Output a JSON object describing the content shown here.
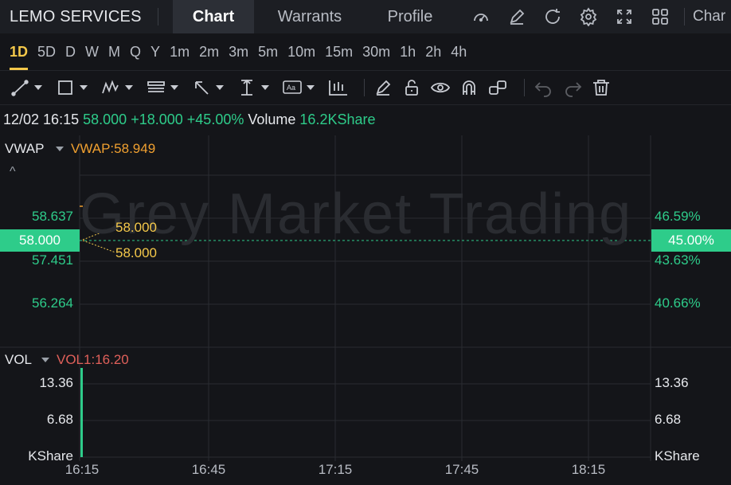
{
  "header": {
    "stock_name": "LEMO SERVICES",
    "tabs": [
      {
        "label": "Chart",
        "active": true
      },
      {
        "label": "Warrants",
        "active": false
      },
      {
        "label": "Profile",
        "active": false
      }
    ],
    "icons": [
      "gauge-icon",
      "edit-icon",
      "refresh-icon",
      "gear-icon",
      "fullscreen-icon",
      "grid-icon"
    ],
    "char_label": "Char"
  },
  "periods": [
    {
      "label": "1D",
      "active": true
    },
    {
      "label": "5D"
    },
    {
      "label": "D"
    },
    {
      "label": "W"
    },
    {
      "label": "M"
    },
    {
      "label": "Q"
    },
    {
      "label": "Y"
    },
    {
      "label": "1m"
    },
    {
      "label": "2m"
    },
    {
      "label": "3m"
    },
    {
      "label": "5m"
    },
    {
      "label": "10m"
    },
    {
      "label": "15m"
    },
    {
      "label": "30m"
    },
    {
      "label": "1h"
    },
    {
      "label": "2h"
    },
    {
      "label": "4h"
    }
  ],
  "tools": [
    "line-tool-icon",
    "rectangle-tool-icon",
    "pattern-tool-icon",
    "fib-tool-icon",
    "arrow-tool-icon",
    "measure-tool-icon",
    "text-tool-icon",
    "indicator-icon",
    "pencil-icon",
    "unlock-icon",
    "eye-icon",
    "magnet-icon",
    "link-icon",
    "undo-icon",
    "redo-icon",
    "trash-icon"
  ],
  "info": {
    "datetime": "12/02 16:15",
    "price": "58.000",
    "change": "+18.000",
    "change_pct": "+45.00%",
    "volume_label": "Volume",
    "volume_value": "16.2KShare"
  },
  "main_panel": {
    "indicator_name": "VWAP",
    "indicator_value": "VWAP:58.949",
    "collapse_symbol": "^",
    "watermark": "Grey Market Trading",
    "left_ticks": [
      "58.637",
      "57.451",
      "56.264"
    ],
    "right_ticks": [
      "46.59%",
      "43.63%",
      "40.66%"
    ],
    "current_price": "58.000",
    "current_pct": "45.00%",
    "annotations": [
      "58.000",
      "58.000"
    ]
  },
  "volume_panel": {
    "indicator_name": "VOL",
    "indicator_value": "VOL1:16.20",
    "left_ticks": [
      "13.36",
      "6.68",
      "KShare"
    ],
    "right_ticks": [
      "13.36",
      "6.68",
      "KShare"
    ]
  },
  "x_axis": [
    "16:15",
    "16:45",
    "17:15",
    "17:45",
    "18:15"
  ],
  "colors": {
    "up": "#2ecc8a",
    "vwap": "#f0a030",
    "active_period": "#f4c84a",
    "vol_indicator": "#e0605a",
    "background": "#141519"
  },
  "chart_data": {
    "type": "line",
    "price": {
      "y": [
        58.0
      ],
      "ylim": [
        55.6,
        59.4
      ],
      "vwap": 58.949
    },
    "volume": {
      "x": [
        "16:15"
      ],
      "values": [
        16.2
      ],
      "unit": "KShare"
    },
    "x": [
      "16:15",
      "16:45",
      "17:15",
      "17:45",
      "18:15"
    ]
  }
}
